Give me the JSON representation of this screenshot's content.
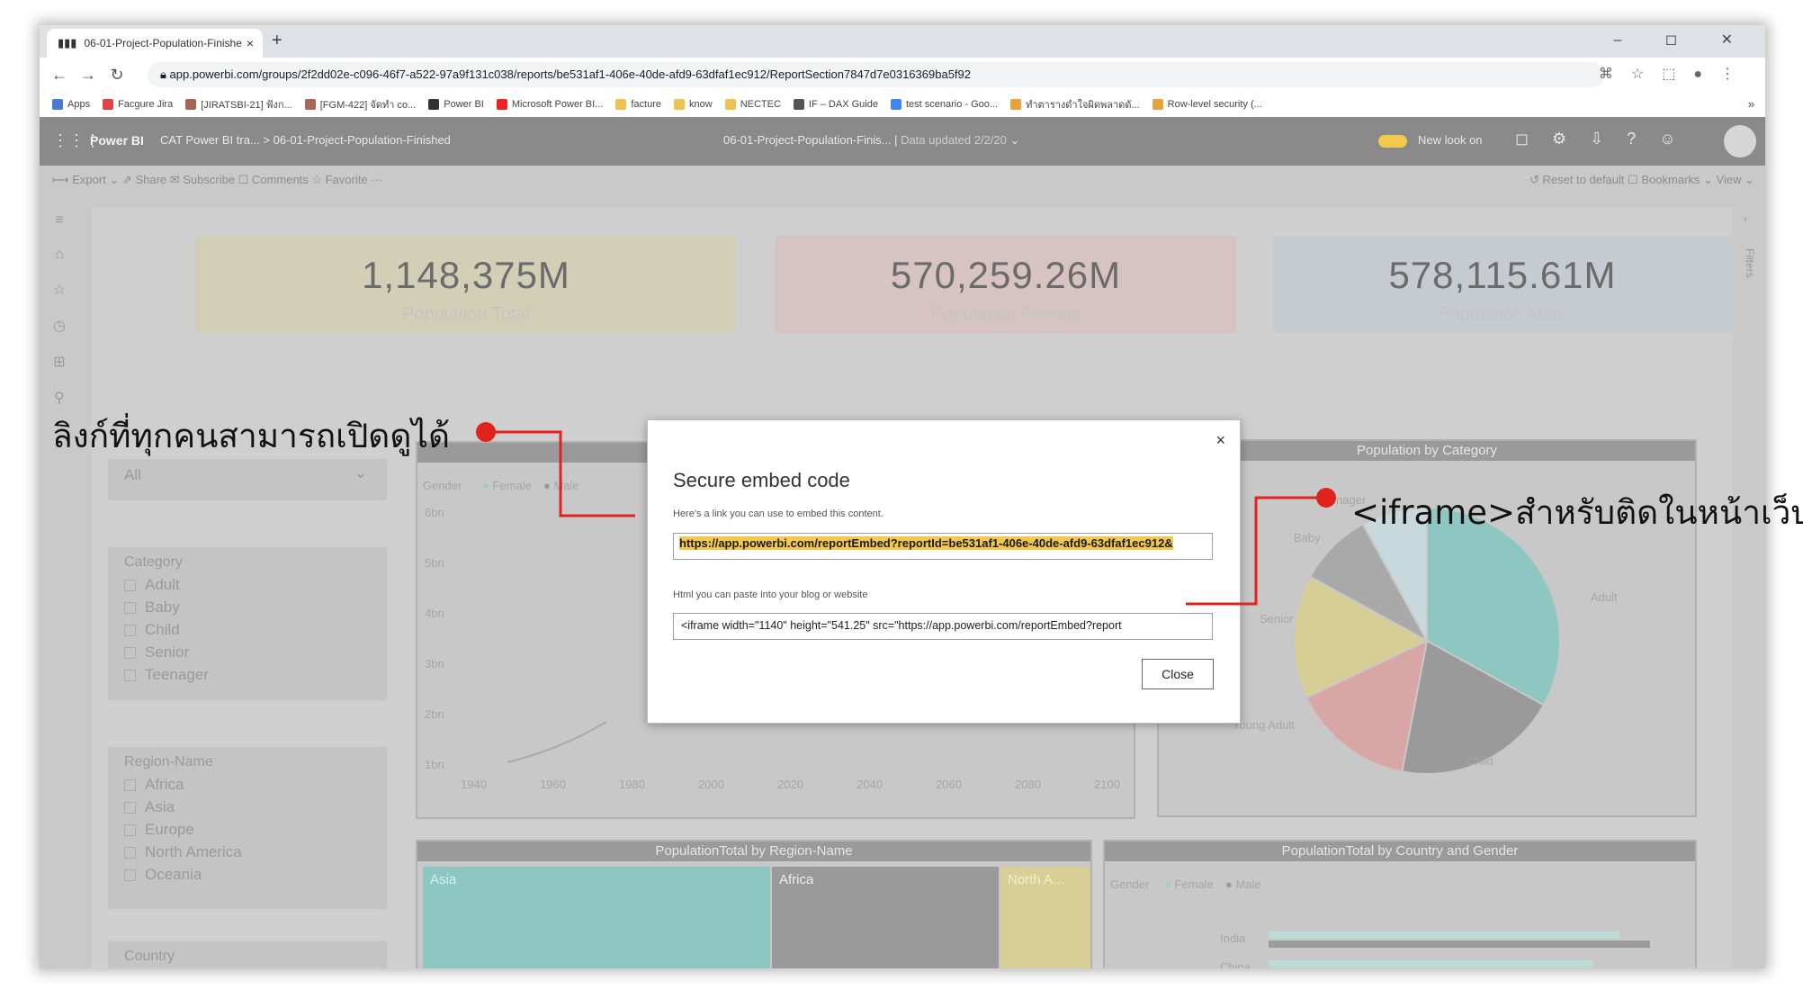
{
  "browser": {
    "tab_title": "06-01-Project-Population-Finishe",
    "tab_close": "×",
    "new_tab": "+",
    "window_controls": "– ◻ ✕",
    "url": "app.powerbi.com/groups/2f2dd02e-c096-46f7-a522-97a9f131c038/reports/be531af1-406e-40de-afd9-63dfaf1ec912/ReportSection7847d7e0316369ba5f92",
    "bookmarks": [
      "Apps",
      "Facgure Jira",
      "[JIRATSBI-21] ฟังก...",
      "[FGM-422] จัดทำ co...",
      "Power BI",
      "Microsoft Power BI...",
      "facture",
      "know",
      "NECTEC",
      "IF – DAX Guide",
      "test scenario - Goo...",
      "ทำตารางดำใจผิดพลาดดั...",
      "Row-level security (..."
    ],
    "bookmarks_more": "»"
  },
  "pbi_header": {
    "brand": "Power BI",
    "crumb_workspace": "CAT Power BI tra...",
    "crumb_sep": ">",
    "crumb_report": "06-01-Project-Population-Finished",
    "center_title": "06-01-Project-Population-Finis...",
    "center_sep": "|",
    "data_updated": "Data updated 2/2/20",
    "new_look": "New look on"
  },
  "action_bar": {
    "left": "⟼ Export ⌄   ⇗ Share   ✉ Subscribe   ☐ Comments   ☆ Favorite   ···",
    "right": "↺ Reset to default   ☐ Bookmarks ⌄   View ⌄"
  },
  "right_rail": {
    "filters": "Filters",
    "chevron": "‹"
  },
  "kpis": [
    {
      "value": "1,148,375M",
      "label": "Population Total",
      "bg": "#d2cfb8"
    },
    {
      "value": "570,259.26M",
      "label": "Population Female",
      "bg": "#d8c4c4"
    },
    {
      "value": "578,115.61M",
      "label": "Population Male",
      "bg": "#c6cbd2"
    }
  ],
  "slicers": {
    "top": {
      "value": "All",
      "chevron": "⌄"
    },
    "category": {
      "title": "Category",
      "options": [
        "Adult",
        "Baby",
        "Child",
        "Senior",
        "Teenager"
      ]
    },
    "region": {
      "title": "Region-Name",
      "options": [
        "Africa",
        "Asia",
        "Europe",
        "North America",
        "Oceania"
      ]
    },
    "country": {
      "title": "Country"
    }
  },
  "line_panel": {
    "legend_label": "Gender",
    "legend_female": "Female",
    "legend_male": "Male",
    "y_ticks": [
      "6bn",
      "5bn",
      "4bn",
      "3bn",
      "2bn",
      "1bn"
    ],
    "x_ticks": [
      "1940",
      "1960",
      "1980",
      "2000",
      "2020",
      "2040",
      "2060",
      "2080",
      "2100"
    ]
  },
  "pie_panel": {
    "title": "Population by Category",
    "labels": [
      "Teenager",
      "Baby",
      "Adult",
      "Senior",
      "Young Adult",
      "Child"
    ]
  },
  "treemap_panel": {
    "title": "PopulationTotal by Region-Name",
    "tiles": [
      "Asia",
      "Africa",
      "North A..."
    ]
  },
  "bar_panel": {
    "title": "PopulationTotal by Country and Gender",
    "legend_label": "Gender",
    "legend_female": "Female",
    "legend_male": "Male",
    "rows": [
      "India",
      "China"
    ]
  },
  "modal": {
    "close_x": "×",
    "title": "Secure embed code",
    "help_link": "Here's a link you can use to embed this content.",
    "link_value": "https://app.powerbi.com/reportEmbed?reportId=be531af1-406e-40de-afd9-63dfaf1ec912&",
    "help_html": "Html you can paste into your blog or website",
    "iframe_value": "<iframe width=\"1140\" height=\"541.25\" src=\"https://app.powerbi.com/reportEmbed?report",
    "close_button": "Close"
  },
  "annotations": {
    "left": "ลิงก์ที่ทุกคนสามารถเปิดดูได้",
    "right": "<iframe>สำหรับติดในหน้าเว็บ",
    "line_color": "#e0231c"
  },
  "chart_data": {
    "type": "pie",
    "title": "Population by Category",
    "categories": [
      "Adult",
      "Child",
      "Young Adult",
      "Senior",
      "Baby",
      "Teenager"
    ],
    "values": [
      33,
      20,
      15,
      15,
      9,
      8
    ]
  }
}
